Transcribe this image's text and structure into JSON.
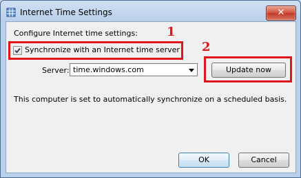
{
  "window": {
    "title": "Internet Time Settings",
    "close_label": "✕"
  },
  "dialog": {
    "configure_label": "Configure Internet time settings:",
    "sync_checkbox_label": "Synchronize with an Internet time server",
    "sync_checked": true,
    "server_label": "Server:",
    "server_value": "time.windows.com",
    "update_button_label": "Update now",
    "status_text": "This computer is set to automatically synchronize on a scheduled basis.",
    "ok_label": "OK",
    "cancel_label": "Cancel"
  },
  "annotations": [
    {
      "number": "1",
      "color": "#e0141b"
    },
    {
      "number": "2",
      "color": "#e0141b"
    }
  ]
}
